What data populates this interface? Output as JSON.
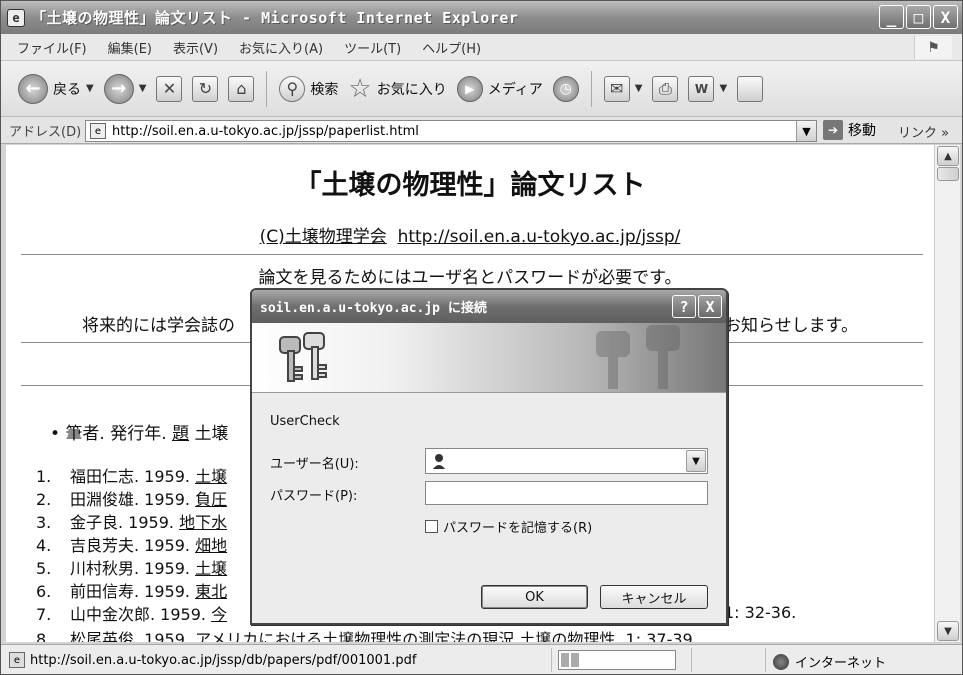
{
  "window": {
    "title": "「土壌の物理性」論文リスト - Microsoft Internet Explorer",
    "controls": {
      "minimize": "_",
      "maximize": "□",
      "close": "X"
    }
  },
  "menubar": {
    "items": [
      "ファイル(F)",
      "編集(E)",
      "表示(V)",
      "お気に入り(A)",
      "ツール(T)",
      "ヘルプ(H)"
    ]
  },
  "toolbar": {
    "back_label": "戻る",
    "search_label": "検索",
    "favorites_label": "お気に入り",
    "media_label": "メディア"
  },
  "addressbar": {
    "label": "アドレス(D)",
    "url": "http://soil.en.a.u-tokyo.ac.jp/jssp/paperlist.html",
    "go_label": "移動",
    "links_label": "リンク »"
  },
  "page": {
    "title": "「土壌の物理性」論文リスト",
    "copyright_prefix": "(C)土壌物理学会",
    "copyright_url": "http://soil.en.a.u-tokyo.ac.jp/jssp/",
    "notice1": "論文を見るためにはユーザ名とパスワードが必要です。",
    "notice2_head": "将来的には学会誌の",
    "notice2_tail": "お知らせします。",
    "bullet": {
      "prefix": "筆者. 発行年.",
      "link": "題",
      "suffix": "土壌"
    },
    "list": [
      {
        "num": "1.",
        "text": "福田仁志. 1959.",
        "link": "土壌"
      },
      {
        "num": "2.",
        "text": "田淵俊雄. 1959.",
        "link": "負圧"
      },
      {
        "num": "3.",
        "text": "金子良. 1959.",
        "link": "地下水"
      },
      {
        "num": "4.",
        "text": "吉良芳夫. 1959.",
        "link": "畑地"
      },
      {
        "num": "5.",
        "text": "川村秋男. 1959.",
        "link": "土壌"
      },
      {
        "num": "6.",
        "text": "前田信寿. 1959.",
        "link": "東北"
      },
      {
        "num": "7.",
        "text": "山中金次郎. 1959.",
        "link": "今"
      }
    ],
    "item7_tail": "1: 32-36.",
    "item8": {
      "num": "8.",
      "text": "松尾英俊. 1959.",
      "link": "アメリカにおける土壌物理性の測定法の現況",
      "suffix": "土壌の物理性. 1: 37-39."
    }
  },
  "statusbar": {
    "url": "http://soil.en.a.u-tokyo.ac.jp/jssp/db/papers/pdf/001001.pdf",
    "progress": 0.18,
    "zone": "インターネット"
  },
  "dialog": {
    "title": "soil.en.a.u-tokyo.ac.jp に接続",
    "help": "?",
    "close": "X",
    "realm": "UserCheck",
    "username_label": "ユーザー名(U):",
    "password_label": "パスワード(P):",
    "remember_label": "パスワードを記憶する(R)",
    "ok_label": "OK",
    "cancel_label": "キャンセル"
  },
  "colors": {
    "titlebar": "#7b7b7b",
    "content_bg": "#ffffff",
    "link": "#111111"
  }
}
